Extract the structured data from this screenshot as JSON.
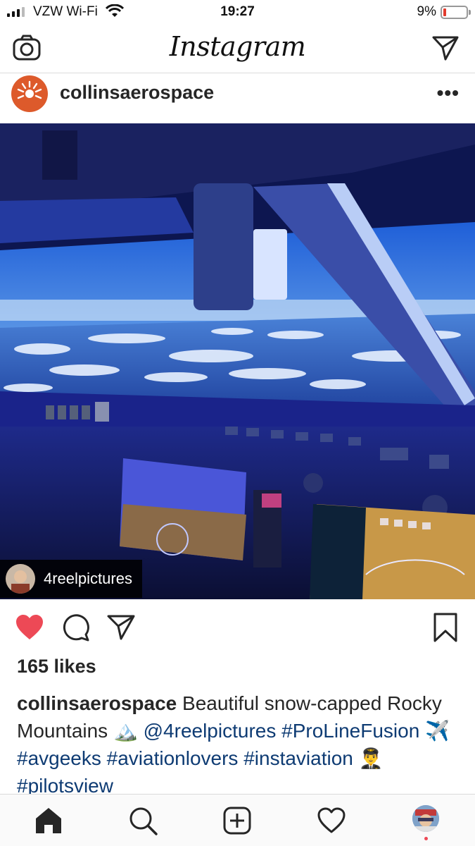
{
  "status": {
    "carrier": "VZW Wi-Fi",
    "time": "19:27",
    "battery": "9%",
    "battery_level": 0.09
  },
  "app": {
    "title": "Instagram"
  },
  "post": {
    "username": "collinsaerospace",
    "more": "•••",
    "photo_tag": "4reelpictures",
    "likes": "165 likes",
    "liked": true,
    "caption": {
      "user": "collinsaerospace",
      "text": "Beautiful snow-capped Rocky Mountains",
      "emoji_mountain": "🏔️",
      "mention": "@4reelpictures",
      "tag1": "#ProLineFusion",
      "emoji_plane": "✈️",
      "tag2": "#avgeeks",
      "tag3": "#aviationlovers",
      "tag4": "#instaviation",
      "emoji_pilot": "👨‍✈️",
      "tag5": "#pilotsview"
    }
  },
  "colors": {
    "like_red": "#ed4956",
    "link_blue": "#0e3b73",
    "brand_orange": "#dd5a2b"
  },
  "icons": {
    "header": [
      "camera-icon",
      "direct-send-icon"
    ],
    "actions": [
      "heart-icon",
      "comment-icon",
      "share-icon",
      "bookmark-icon"
    ],
    "nav": [
      "home-icon",
      "search-icon",
      "new-post-icon",
      "activity-heart-icon",
      "profile-avatar"
    ]
  }
}
